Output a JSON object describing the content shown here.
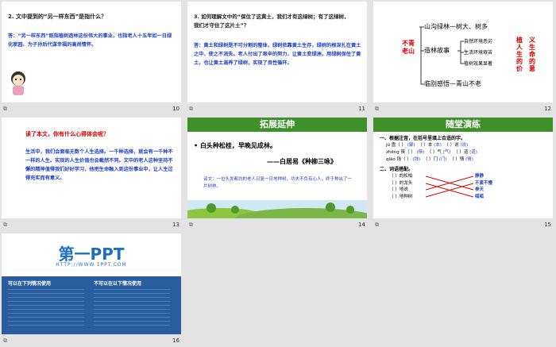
{
  "slides": [
    {
      "num": "10",
      "q": "2. 文中提到的“另一样东西”是指什么？",
      "a": "答：“另一样东西”既指植树造林这份伟大的事业，也指老人十五年如一日绿化家园、为子孙后代谋幸福的高尚情怀。"
    },
    {
      "num": "11",
      "q": "3. 如何理解文中的“保住了这黄土，我们才有这绿树；有了这绿树，我们才守住了这片土”？",
      "a": "答：黄土和绿树是不可分割的整体，绿树依靠黄土生存，绿树的根深扎在黄土之中，使之不流失。老人付出了艰辛的努力，让黄土变绿洲，用绿树保住了黄土，也让黄土滋养了绿树，实现了良性循环。"
    },
    {
      "num": "12",
      "left": "不青老山",
      "top": "山沟绿林—树大、树多",
      "mid": "造林故事",
      "items": [
        "自然环境恶劣",
        "生活环境艰苦",
        "植树效果显著"
      ],
      "bottom": "临别感悟—青山不老",
      "right1": "植人生的价",
      "right2": "义生命的意"
    },
    {
      "num": "13",
      "q": "读了本文，你有什么心得体会呢？",
      "a": "生活中，我们会面临无数个人生选择。一千种选择，就会有一千种不一样的人生。实现的人生价值也会截然不同。文中的老人这种坚持不懈的精神值得我们好好学习，他把生命融入到这份事业中，让人生过得充实而有意义。"
    },
    {
      "num": "14",
      "title": "拓展延伸",
      "poem": "• 白头种松桂，早晚见成林。",
      "author": "——白居易《种柳三咏》",
      "note": "译文：一位头发都白的老人日复一日地种树，功夫不负有心人，终于种出了一片树林。"
    },
    {
      "num": "15",
      "title": "随堂演练",
      "q1": "一、根据注音，在括号里填上合适的字。",
      "pinyin": [
        [
          "jù 盘（ ）",
          "(聚)",
          "（ ）本",
          "(本)",
          "（ ）说",
          "(说)"
        ],
        [
          "zhēng 筷（ ）",
          "(筷)",
          "（ ）气",
          "(气)",
          "（ ）道",
          "(道)"
        ],
        [
          "qiāo 钱（ ）",
          "(钱)",
          "（ ）门",
          "(门)",
          "（ ）情",
          "(情)"
        ]
      ],
      "q2": "二、词语搭配。",
      "lpairs": [
        "（ ）的松柏",
        "（ ）的龙头",
        "（ ）地说",
        "（ ）地种树"
      ],
      "rpairs": [
        "静静",
        "不紧不慢",
        "参天",
        "呱呱"
      ]
    },
    {
      "num": "16",
      "logo": "第一PPT",
      "url": "HTTP://WWW.1PPT.COM",
      "col1": "可以在下列情况使用",
      "col2": "不可以在以下情况使用"
    }
  ]
}
